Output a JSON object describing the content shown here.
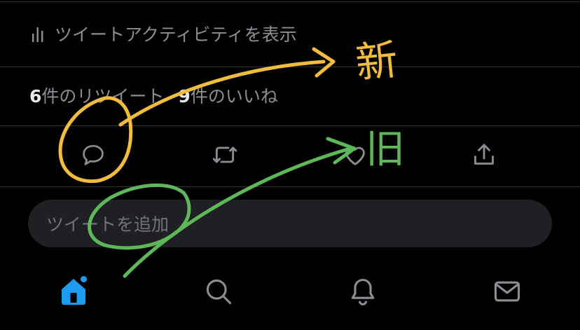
{
  "tweet_detail": {
    "activity_label": "ツイートアクティビティを表示",
    "retweet_count": "6",
    "retweet_label": "件のリツイート",
    "like_count": "9",
    "like_label": "件のいいね"
  },
  "compose": {
    "placeholder": "ツイートを追加"
  },
  "annotations": {
    "new_label": "新",
    "old_label": "旧",
    "colors": {
      "new": "#f2bd3c",
      "old": "#5eb85a"
    }
  },
  "action_icons": [
    "reply-icon",
    "retweet-icon",
    "like-icon",
    "share-icon"
  ],
  "tab_icons": [
    "home-icon",
    "search-icon",
    "notifications-icon",
    "messages-icon"
  ],
  "colors": {
    "accent": "#1d9bf0",
    "icon": "#8b8f93",
    "divider": "#2f3336"
  }
}
